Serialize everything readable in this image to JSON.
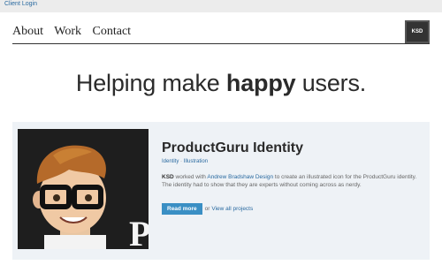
{
  "topbar": {
    "client_login": "Client Login"
  },
  "nav": {
    "items": [
      "About",
      "Work",
      "Contact"
    ]
  },
  "logo": {
    "text": "KSD"
  },
  "hero": {
    "before": "Helping make ",
    "emphasis": "happy",
    "after": " users."
  },
  "project": {
    "title": "ProductGuru Identity",
    "tags": [
      "Identity",
      "Illustration"
    ],
    "tag_separator": "·",
    "desc_company": "KSD",
    "desc_part1": " worked with ",
    "desc_link": "Andrew Bradshaw Design",
    "desc_part2": " to create an illustrated icon for the ProductGuru identity. The identity had to show that they are experts without coming across as nerdy.",
    "read_more": "Read more",
    "or_text": "or",
    "view_all": "View all projects",
    "thumb_letter": "P"
  },
  "colors": {
    "accent": "#3a8fc4",
    "link": "#2a6aa0",
    "card_bg": "#eef2f6"
  }
}
